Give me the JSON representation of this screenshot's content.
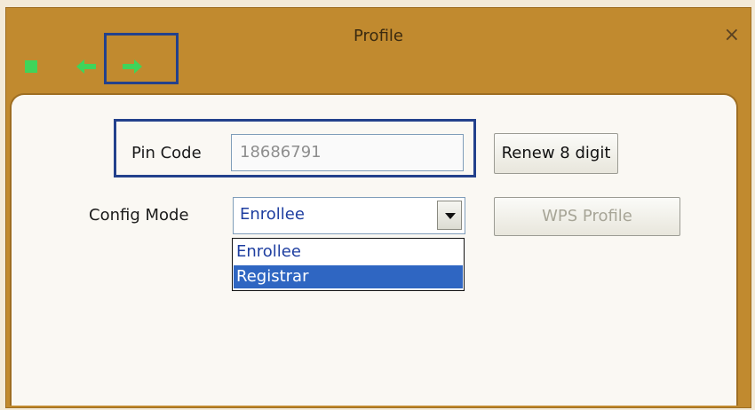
{
  "window": {
    "title": "Profile",
    "close_symbol": "×"
  },
  "toolbar": {
    "icons": [
      "stop-icon",
      "back-arrow-icon",
      "forward-arrow-icon"
    ],
    "accent_color": "#3fd45a",
    "highlight_color": "#23418c"
  },
  "form": {
    "pin_code": {
      "label": "Pin Code",
      "value": "18686791"
    },
    "renew_button": "Renew 8 digit",
    "config_mode": {
      "label": "Config Mode",
      "selected": "Enrollee",
      "options": [
        "Enrollee",
        "Registrar"
      ],
      "highlighted_option": "Registrar"
    },
    "wps_profile_button": "WPS Profile"
  }
}
